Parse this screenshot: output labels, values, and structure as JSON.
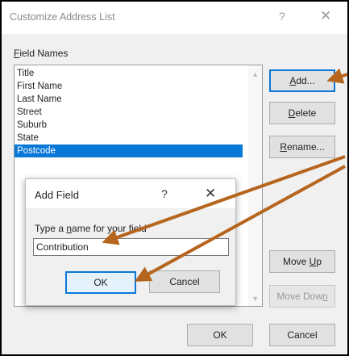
{
  "dialog": {
    "title": "Customize Address List",
    "help_glyph": "?",
    "close_glyph": "✕"
  },
  "field_names": {
    "label_prefix": "",
    "label_underlined": "F",
    "label_rest": "ield Names",
    "items": [
      "Title",
      "First Name",
      "Last Name",
      "Street",
      "Suburb",
      "State",
      "Postcode"
    ],
    "selected_index": 6
  },
  "buttons": {
    "add": {
      "mn": "A",
      "rest": "dd..."
    },
    "delete": {
      "mn": "D",
      "rest": "elete"
    },
    "rename": {
      "mn": "R",
      "rest": "ename..."
    },
    "move_up": {
      "pre": "Move ",
      "mn": "U",
      "rest": "p"
    },
    "move_down": {
      "pre": "Move Dow",
      "mn": "n",
      "rest": ""
    },
    "ok": "OK",
    "cancel": "Cancel"
  },
  "add_field_dialog": {
    "title": "Add Field",
    "help_glyph": "?",
    "close_glyph": "✕",
    "prompt_pre": "Type a ",
    "prompt_mn": "n",
    "prompt_post": "ame for your field",
    "input_value": "Contribution",
    "ok_label": "OK",
    "cancel_label": "Cancel"
  },
  "colors": {
    "selection": "#0a78d7",
    "annotation_arrow": "#b5651d"
  }
}
